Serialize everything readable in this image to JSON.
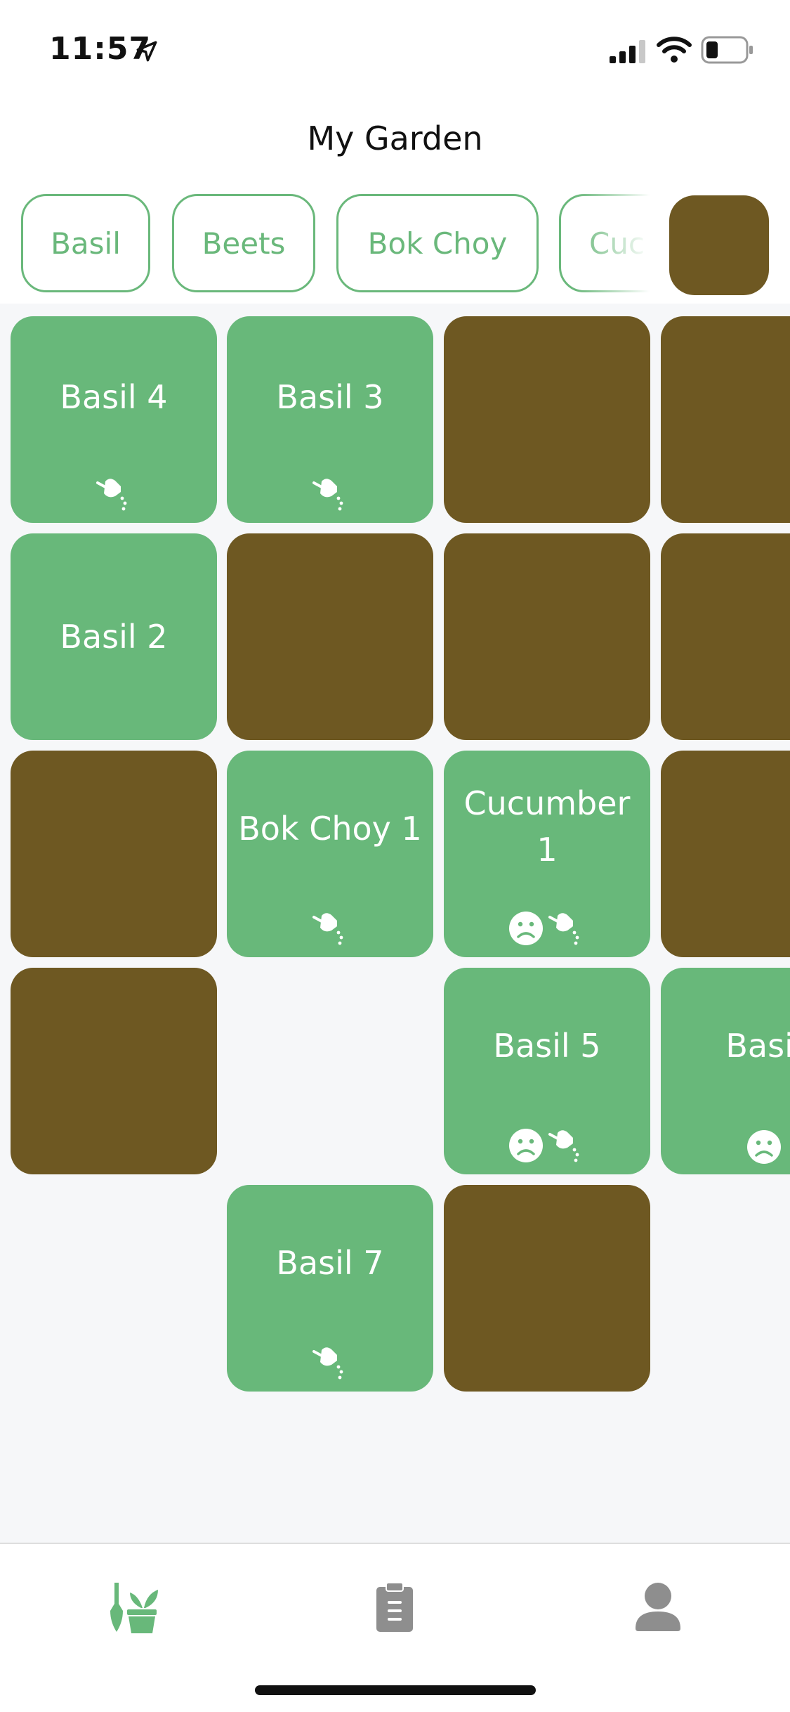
{
  "status_bar": {
    "time": "11:57",
    "icons": [
      "location-arrow-icon",
      "signal-bars-icon",
      "wifi-icon",
      "battery-low-icon"
    ]
  },
  "header": {
    "title": "My Garden"
  },
  "plant_chips": [
    "Basil",
    "Beets",
    "Bok Choy",
    "Cuc"
  ],
  "grid": {
    "rows": [
      [
        {
          "type": "plant",
          "label": "Basil 4",
          "icons": [
            "watering-can-icon"
          ]
        },
        {
          "type": "plant",
          "label": "Basil 3",
          "icons": [
            "watering-can-icon"
          ]
        },
        {
          "type": "soil"
        },
        {
          "type": "soil"
        }
      ],
      [
        {
          "type": "plant",
          "label": "Basil 2",
          "icons": []
        },
        {
          "type": "soil"
        },
        {
          "type": "soil"
        },
        {
          "type": "soil"
        }
      ],
      [
        {
          "type": "soil"
        },
        {
          "type": "plant",
          "label": "Bok Choy 1",
          "icons": [
            "watering-can-icon"
          ]
        },
        {
          "type": "plant",
          "label": "Cucumber 1",
          "icons": [
            "sad-face-icon",
            "watering-can-icon"
          ]
        },
        {
          "type": "soil"
        }
      ],
      [
        {
          "type": "soil"
        },
        {
          "type": "empty"
        },
        {
          "type": "plant",
          "label": "Basil 5",
          "icons": [
            "sad-face-icon",
            "watering-can-icon"
          ]
        },
        {
          "type": "plant",
          "label": "Basil",
          "icons": [
            "sad-face-icon"
          ]
        }
      ],
      [
        {
          "type": "empty"
        },
        {
          "type": "plant",
          "label": "Basil 7",
          "icons": [
            "watering-can-icon"
          ]
        },
        {
          "type": "soil"
        },
        {
          "type": "empty"
        }
      ]
    ]
  },
  "tab_bar": {
    "tabs": [
      {
        "name": "garden",
        "icon": "garden-tools-icon",
        "active": true
      },
      {
        "name": "tasks",
        "icon": "clipboard-icon",
        "active": false
      },
      {
        "name": "profile",
        "icon": "user-icon",
        "active": false
      }
    ]
  },
  "colors": {
    "plant_green": "#68b87a",
    "soil_brown": "#6e5822",
    "chip_border": "#6ab87b",
    "inactive_tab": "#8e8e8e"
  }
}
